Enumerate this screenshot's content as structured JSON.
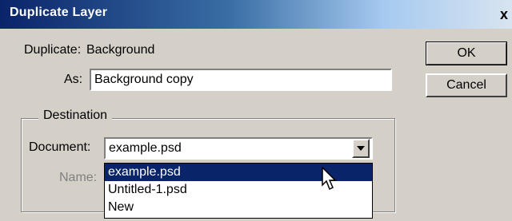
{
  "dialog": {
    "title": "Duplicate Layer",
    "close_glyph": "x"
  },
  "duplicate": {
    "label": "Duplicate:",
    "value": "Background"
  },
  "as_field": {
    "label": "As:",
    "value": "Background copy"
  },
  "buttons": {
    "ok": "OK",
    "cancel": "Cancel"
  },
  "destination": {
    "legend": "Destination",
    "document_label": "Document:",
    "document_value": "example.psd",
    "name_label": "Name:",
    "options": [
      "example.psd",
      "Untitled-1.psd",
      "New"
    ],
    "selected_index": 0
  },
  "colors": {
    "title_bar": "#0a246a",
    "selection": "#0a246a",
    "face": "#d4d0c8"
  },
  "icons": {
    "close": "close-icon",
    "combo_arrow": "chevron-down-icon",
    "pointer": "mouse-pointer-icon"
  }
}
